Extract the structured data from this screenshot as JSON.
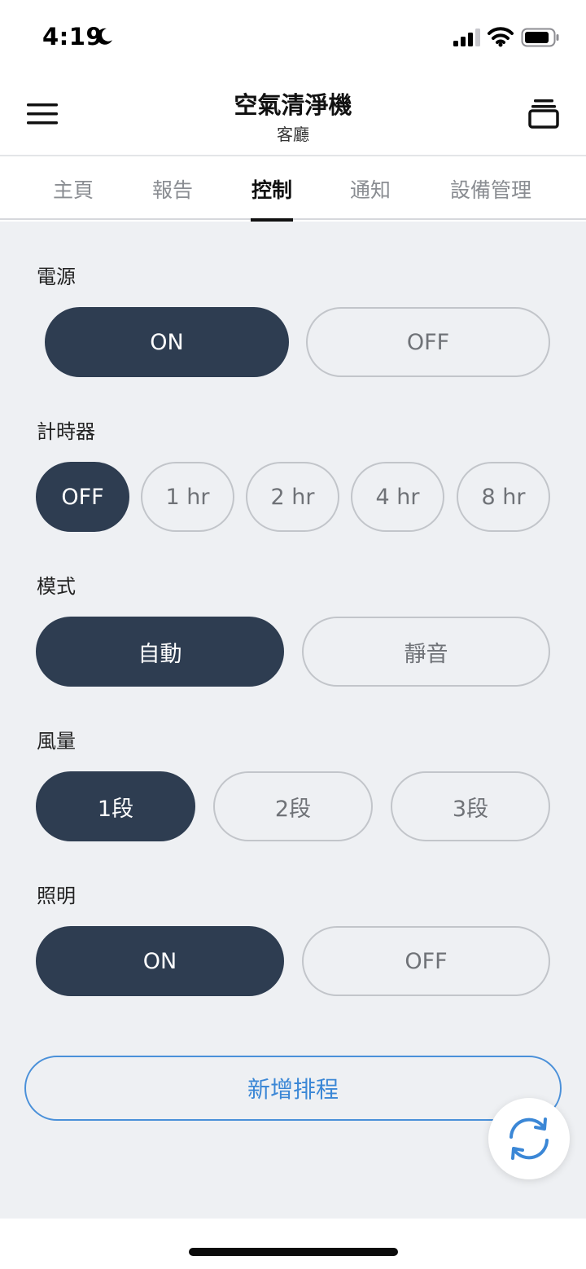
{
  "status_bar": {
    "time": "4:19",
    "icons": [
      "moon-icon",
      "signal-icon",
      "wifi-icon",
      "battery-icon"
    ]
  },
  "header": {
    "title": "空氣清淨機",
    "subtitle": "客廳",
    "left_icon": "menu-icon",
    "right_icon": "stack-icon"
  },
  "tabs": [
    {
      "label": "主頁",
      "active": false
    },
    {
      "label": "報告",
      "active": false
    },
    {
      "label": "控制",
      "active": true
    },
    {
      "label": "通知",
      "active": false
    },
    {
      "label": "設備管理",
      "active": false
    }
  ],
  "controls": {
    "power": {
      "label": "電源",
      "options": [
        "ON",
        "OFF"
      ],
      "selected": "ON"
    },
    "timer": {
      "label": "計時器",
      "options": [
        "OFF",
        "1 hr",
        "2 hr",
        "4 hr",
        "8 hr"
      ],
      "selected": "OFF"
    },
    "mode": {
      "label": "模式",
      "options": [
        "自動",
        "靜音"
      ],
      "selected": "自動"
    },
    "fan": {
      "label": "風量",
      "options": [
        "1段",
        "2段",
        "3段"
      ],
      "selected": "1段"
    },
    "light": {
      "label": "照明",
      "options": [
        "ON",
        "OFF"
      ],
      "selected": "ON"
    }
  },
  "schedule": {
    "label": "新增排程"
  },
  "refresh": {
    "icon": "refresh-icon"
  },
  "colors": {
    "selected_fill": "#2e3d51",
    "panel_background": "#eef0f3",
    "accent_blue": "#3b87d6"
  }
}
